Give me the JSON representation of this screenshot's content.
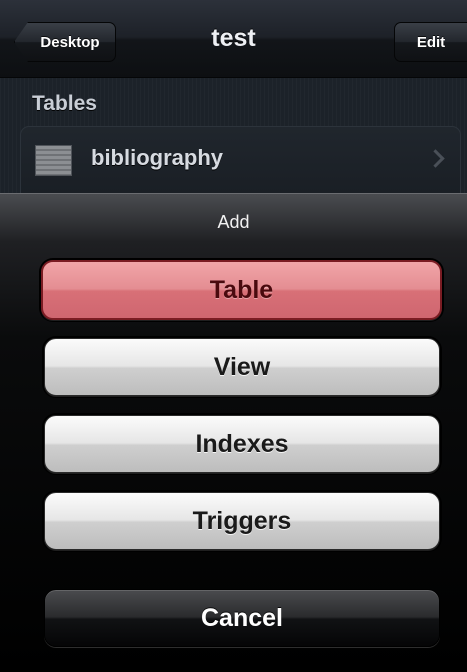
{
  "navbar": {
    "back_label": "Desktop",
    "title": "test",
    "edit_label": "Edit"
  },
  "content": {
    "section_header": "Tables",
    "rows": [
      {
        "label": "bibliography",
        "icon": "table-icon"
      }
    ]
  },
  "action_sheet": {
    "title": "Add",
    "buttons": {
      "table": "Table",
      "view": "View",
      "indexes": "Indexes",
      "triggers": "Triggers",
      "cancel": "Cancel"
    }
  },
  "colors": {
    "destructive_button": "#e48d92",
    "destructive_text": "#4a0a0e",
    "navbar": "#1d2128",
    "sheet_background": "#000000"
  }
}
